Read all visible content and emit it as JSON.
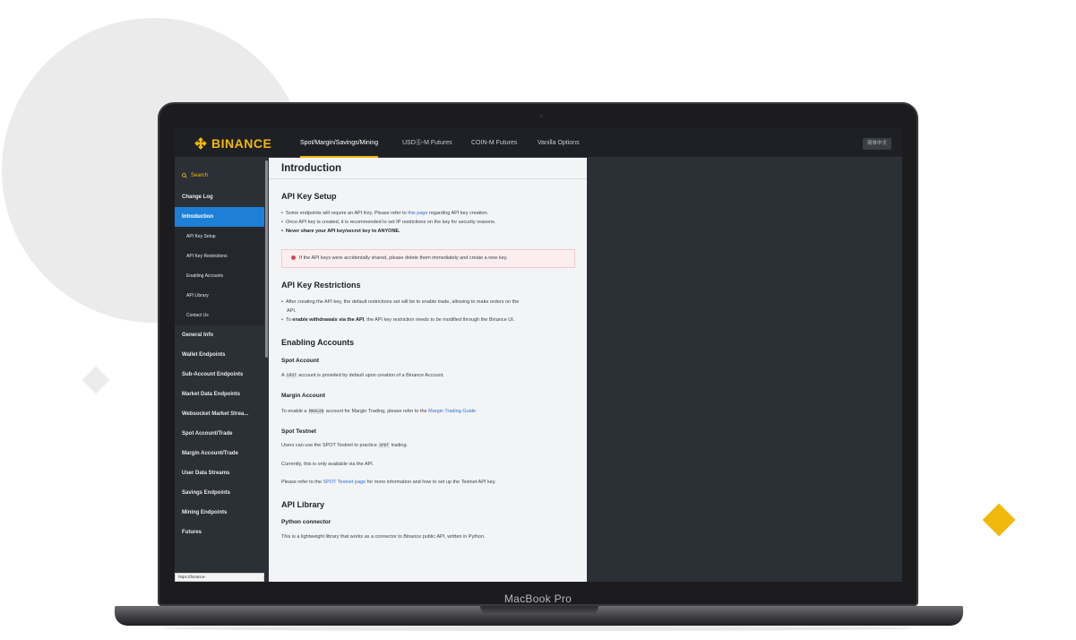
{
  "device": {
    "label": "MacBook Pro"
  },
  "colors": {
    "brand": "#f0b90b",
    "sidebar_active": "#1e7fd6",
    "link": "#2f6fd0",
    "page_bg": "#2b2f36"
  },
  "topbar": {
    "logo_text": "BINANCE",
    "tabs": [
      {
        "label": "Spot/Margin/Savings/Mining",
        "active": true
      },
      {
        "label": "USDⓈ-M Futures",
        "active": false
      },
      {
        "label": "COIN-M Futures",
        "active": false
      },
      {
        "label": "Vanilla Options",
        "active": false
      }
    ],
    "lang_button": "简体中文"
  },
  "sidebar": {
    "search_label": "Search",
    "items": [
      {
        "label": "Change Log"
      },
      {
        "label": "Introduction",
        "active": true
      },
      {
        "label": "API Key Setup",
        "sub": true
      },
      {
        "label": "API Key Restrictions",
        "sub": true
      },
      {
        "label": "Enabling Accounts",
        "sub": true
      },
      {
        "label": "API Library",
        "sub": true
      },
      {
        "label": "Contact Us",
        "sub": true
      },
      {
        "label": "General Info"
      },
      {
        "label": "Wallet Endpoints"
      },
      {
        "label": "Sub-Account Endpoints"
      },
      {
        "label": "Market Data Endpoints"
      },
      {
        "label": "Websocket Market Strea..."
      },
      {
        "label": "Spot Account/Trade"
      },
      {
        "label": "Margin Account/Trade"
      },
      {
        "label": "User Data Streams"
      },
      {
        "label": "Savings Endpoints"
      },
      {
        "label": "Mining Endpoints"
      },
      {
        "label": "Futures"
      }
    ],
    "status_url": "https://binance-docs.github.io/apidocs/spot/en/"
  },
  "content": {
    "title": "Introduction",
    "api_key_setup": {
      "heading": "API Key Setup",
      "b1_pre": "Some endpoints will require an API Key. Please refer to ",
      "b1_link": "this page",
      "b1_post": " regarding API key creation.",
      "b2": "Once API key is created, it is recommended to set IP restrictions on the key for security reasons.",
      "b3": "Never share your API key/secret key to ANYONE.",
      "warning": "If the API keys were accidentally shared, please delete them immediately and create a new key."
    },
    "api_key_restrictions": {
      "heading": "API Key Restrictions",
      "b1_line1": "After creating the API key, the default restrictions set will be to enable trade, allowing to make orders on the",
      "b1_line2": "API.",
      "b2_pre": "To ",
      "b2_bold": "enable withdrawals via the API",
      "b2_post": ", the API key restriction needs to be modified through the Binance UI."
    },
    "enabling_accounts": {
      "heading": "Enabling Accounts",
      "spot_heading": "Spot Account",
      "spot_pre": "A ",
      "spot_code": "SPOT",
      "spot_post": " account is provided by default upon creation of a Binance Account.",
      "margin_heading": "Margin Account",
      "margin_pre": "To enable a ",
      "margin_code": "MARGIN",
      "margin_mid": " account for Margin Trading, please refer to the ",
      "margin_link": "Margin Trading Guide",
      "testnet_heading": "Spot Testnet",
      "testnet_pre": "Users can use the SPOT Testnet to practice ",
      "testnet_code": "SPOT",
      "testnet_post": " trading.",
      "testnet_p2": "Currently, this is only available via the API.",
      "testnet_p3_pre": "Please refer to the ",
      "testnet_p3_link": "SPOT Testnet page",
      "testnet_p3_post": " for more information and how to set up the Testnet API key."
    },
    "api_library": {
      "heading": "API Library",
      "python_heading": "Python connector",
      "python_text": "This is a lightweight library that works as a connector to Binance public API, written in Python."
    }
  }
}
